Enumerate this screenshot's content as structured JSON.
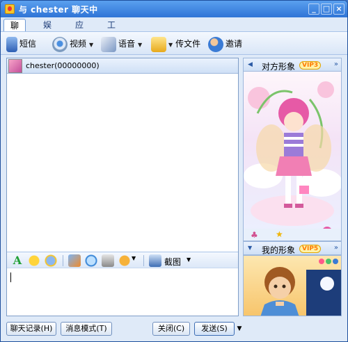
{
  "window": {
    "title": "与 chester 聊天中",
    "minimize_glyph": "_",
    "maximize_glyph": "□",
    "close_glyph": "×"
  },
  "tabs": [
    {
      "label": "聊天",
      "active": true
    },
    {
      "label": "娱乐",
      "active": false
    },
    {
      "label": "应用",
      "active": false
    },
    {
      "label": "工具",
      "active": false
    }
  ],
  "toolbar": {
    "sms": {
      "label": "短信",
      "icon": "sms-phone-icon"
    },
    "video": {
      "label": "视频",
      "icon": "webcam-icon"
    },
    "voice": {
      "label": "语音",
      "icon": "microphone-icon"
    },
    "file": {
      "label": "传文件",
      "icon": "folder-send-icon"
    },
    "invite": {
      "label": "邀请",
      "icon": "add-user-icon"
    },
    "dropdown_glyph": "▼"
  },
  "contact": {
    "name": "chester",
    "id_text": "(00000000)"
  },
  "input_toolbar": {
    "font_glyph": "A",
    "screenshot_label": "截图",
    "icons": [
      "font-icon",
      "emoticon-icon",
      "magic-face-icon",
      "send-image-icon",
      "chat-bubble-icon",
      "music-icon",
      "wink-icon",
      "screenshot-icon"
    ]
  },
  "side": {
    "peer_show_label": "对方形象",
    "my_show_label": "我的形象",
    "peer_vip": "VIP3",
    "my_vip": "VIP5",
    "collapse_glyph": "◀",
    "more_glyph": "»"
  },
  "bottom": {
    "history_label": "聊天记录(H)",
    "mode_label": "消息模式(T)",
    "close_label": "关闭(C)",
    "send_label": "发送(S)",
    "send_dropdown_glyph": "▼"
  },
  "colors": {
    "titlebar": "#2f74d6",
    "window_bg": "#dfeaf8",
    "border": "#7f9dc7"
  }
}
